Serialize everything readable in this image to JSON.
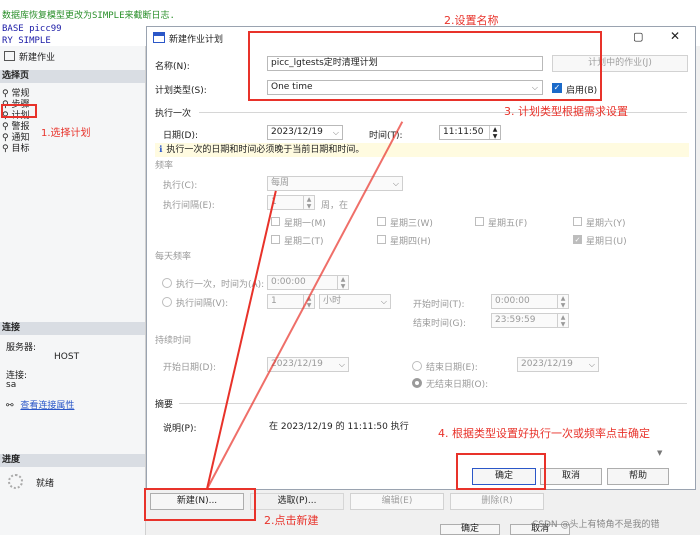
{
  "background": {
    "code_lines": [
      "数据库恢复模型更改为SIMPLE来截断日志.",
      "BASE picc99",
      "RY SIMPLE"
    ],
    "new_job_title": "新建作业",
    "select_page_header": "选择页",
    "pages": [
      "常规",
      "步骤",
      "计划",
      "警报",
      "通知",
      "目标"
    ],
    "connection_header": "连接",
    "server_label": "服务器:",
    "server_value": "HOST",
    "connection_label": "连接:",
    "connection_value": "sa",
    "view_conn_props": "查看连接属性",
    "progress_header": "进度",
    "progress_status": "就绪",
    "bottom_buttons": [
      "确定",
      "取消"
    ]
  },
  "dialog": {
    "title": "新建作业计划",
    "name_label": "名称(N):",
    "name_value": "picc_lgtests定时清理计划",
    "jobs_in_schedule": "计划中的作业(J)",
    "schedule_type_label": "计划类型(S):",
    "schedule_type_value": "One time",
    "enabled_label": "启用(B)",
    "enabled_checked": true,
    "one_time_section": "执行一次",
    "date_label": "日期(D):",
    "date_value": "2023/12/19",
    "time_label": "时间(T):",
    "time_value": "11:11:50",
    "info_text": "执行一次的日期和时间必须晚于当前日期和时间。",
    "frequency_section": "频率",
    "occurs_label": "执行(C):",
    "occurs_value": "每周",
    "recurs_label": "执行间隔(E):",
    "recurs_value": "1",
    "recurs_unit": "周，在",
    "weekdays": [
      "星期一(M)",
      "星期二(T)",
      "星期三(W)",
      "星期四(H)",
      "星期五(F)",
      "星期六(Y)",
      "星期日(U)"
    ],
    "daily_section": "每天频率",
    "occurs_once_label": "执行一次，时间为(A):",
    "occurs_once_value": "0:00:00",
    "occurs_every_label": "执行间隔(V):",
    "occurs_every_value": "1",
    "occurs_every_unit": "小时",
    "start_time_label": "开始时间(T):",
    "start_time_value": "0:00:00",
    "end_time_label": "结束时间(G):",
    "end_time_value": "23:59:59",
    "duration_section": "持续时间",
    "start_date_label": "开始日期(D):",
    "start_date_value": "2023/12/19",
    "end_date_label": "结束日期(E):",
    "end_date_value": "2023/12/19",
    "no_end_date_label": "无结束日期(O):",
    "summary_section": "摘要",
    "description_label": "说明(P):",
    "description_value": "在 2023/12/19 的 11:11:50 执行",
    "ok": "确定",
    "cancel": "取消",
    "help": "帮助"
  },
  "schedule_buttons": {
    "new": "新建(N)...",
    "pick": "选取(P)...",
    "edit": "编辑(E)",
    "remove": "删除(R)"
  },
  "annotations": {
    "a1": "1.选择计划",
    "a2": "2.设置名称",
    "a3": "3. 计划类型根据需求设置",
    "a4": "4. 根据类型设置好执行一次或频率点击确定",
    "a5": "2.点击新建"
  },
  "watermark": "CSDN @头上有犄角不是我的错",
  "colors": {
    "annotation_red": "#e8322a",
    "info_bg": "#fffbe0",
    "checkbox_blue": "#1b6ac9"
  }
}
